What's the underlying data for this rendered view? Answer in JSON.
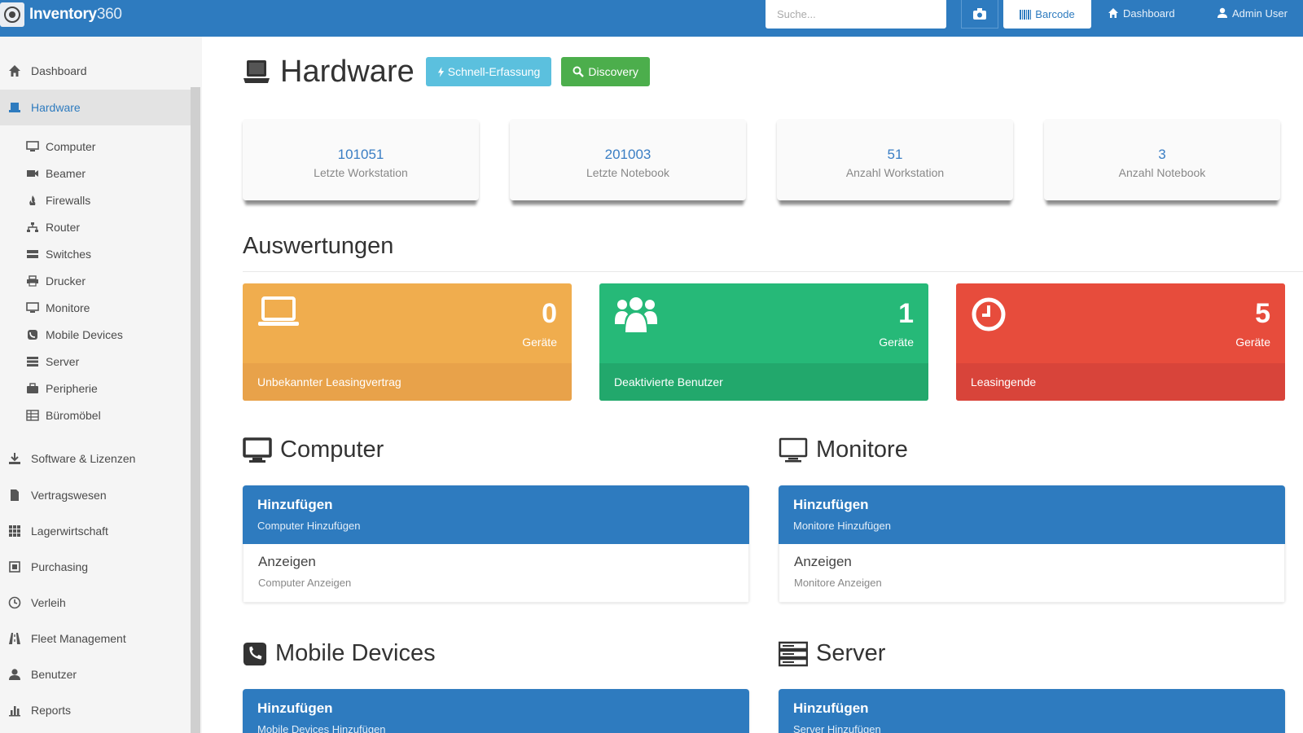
{
  "navbar": {
    "brand_bold": "Inventory",
    "brand_thin": "360",
    "search_placeholder": "Suche...",
    "barcode_label": "Barcode",
    "dashboard_label": "Dashboard",
    "user_label": "Admin User",
    "color": "#2e7bbf"
  },
  "sidebar": {
    "items": [
      {
        "label": "Dashboard",
        "icon": "home-icon"
      },
      {
        "label": "Hardware",
        "icon": "laptop-icon",
        "active": true
      },
      {
        "label": "Software & Lizenzen",
        "icon": "download-icon"
      },
      {
        "label": "Vertragswesen",
        "icon": "file-icon"
      },
      {
        "label": "Lagerwirtschaft",
        "icon": "grid-icon"
      },
      {
        "label": "Purchasing",
        "icon": "shopping-icon"
      },
      {
        "label": "Verleih",
        "icon": "clock-icon"
      },
      {
        "label": "Fleet Management",
        "icon": "road-icon"
      },
      {
        "label": "Benutzer",
        "icon": "user-icon"
      },
      {
        "label": "Reports",
        "icon": "stats-icon"
      }
    ],
    "sub_items": [
      {
        "label": "Computer",
        "icon": "monitor-icon"
      },
      {
        "label": "Beamer",
        "icon": "camera-icon"
      },
      {
        "label": "Firewalls",
        "icon": "fire-icon"
      },
      {
        "label": "Router",
        "icon": "network-icon"
      },
      {
        "label": "Switches",
        "icon": "switch-icon"
      },
      {
        "label": "Drucker",
        "icon": "print-icon"
      },
      {
        "label": "Monitore",
        "icon": "monitor-icon"
      },
      {
        "label": "Mobile Devices",
        "icon": "phone-icon"
      },
      {
        "label": "Server",
        "icon": "server-icon"
      },
      {
        "label": "Peripherie",
        "icon": "briefcase-icon"
      },
      {
        "label": "Büromöbel",
        "icon": "table-icon"
      }
    ]
  },
  "header": {
    "title": "Hardware",
    "quick_button": "Schnell-Erfassung",
    "discovery_button": "Discovery"
  },
  "stats": [
    {
      "value": "101051",
      "label": "Letzte Workstation"
    },
    {
      "value": "201003",
      "label": "Letzte Notebook"
    },
    {
      "value": "51",
      "label": "Anzahl Workstation"
    },
    {
      "value": "3",
      "label": "Anzahl Notebook"
    }
  ],
  "evaluations": {
    "title": "Auswertungen",
    "tiles": [
      {
        "value": "0",
        "unit": "Geräte",
        "footer": "Unbekannter Leasingvertrag",
        "color": "#f0ad4e",
        "icon": "laptop-icon"
      },
      {
        "value": "1",
        "unit": "Geräte",
        "footer": "Deaktivierte Benutzer",
        "color": "#26b978",
        "icon": "users-icon"
      },
      {
        "value": "5",
        "unit": "Geräte",
        "footer": "Leasingende",
        "color": "#e74c3c",
        "icon": "clock-icon"
      }
    ]
  },
  "sections": [
    {
      "title": "Computer",
      "icon": "monitor-icon",
      "add_title": "Hinzufügen",
      "add_sub": "Computer Hinzufügen",
      "show_title": "Anzeigen",
      "show_sub": "Computer Anzeigen"
    },
    {
      "title": "Monitore",
      "icon": "monitor-icon",
      "add_title": "Hinzufügen",
      "add_sub": "Monitore Hinzufügen",
      "show_title": "Anzeigen",
      "show_sub": "Monitore Anzeigen"
    },
    {
      "title": "Mobile Devices",
      "icon": "phone-icon",
      "add_title": "Hinzufügen",
      "add_sub": "Mobile Devices Hinzufügen"
    },
    {
      "title": "Server",
      "icon": "server-icon",
      "add_title": "Hinzufügen",
      "add_sub": "Server Hinzufügen"
    }
  ]
}
